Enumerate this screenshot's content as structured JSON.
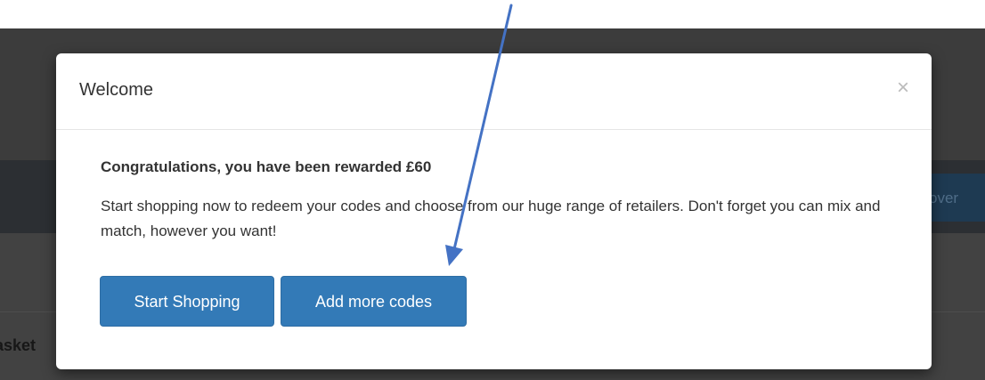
{
  "background": {
    "side_button_label": "over",
    "side_label": "asket"
  },
  "modal": {
    "title": "Welcome",
    "close_glyph": "×",
    "heading": "Congratulations, you have been rewarded £60",
    "message": "Start shopping now to redeem your codes and choose from our huge range of retailers. Don't forget you can mix and match, however you want!",
    "buttons": {
      "start_shopping": "Start Shopping",
      "add_more_codes": "Add more codes"
    }
  },
  "colors": {
    "primary_button": "#337ab7",
    "annotation_arrow": "#4472c4"
  },
  "annotation": {
    "type": "arrow",
    "target": "add-more-codes-button"
  }
}
